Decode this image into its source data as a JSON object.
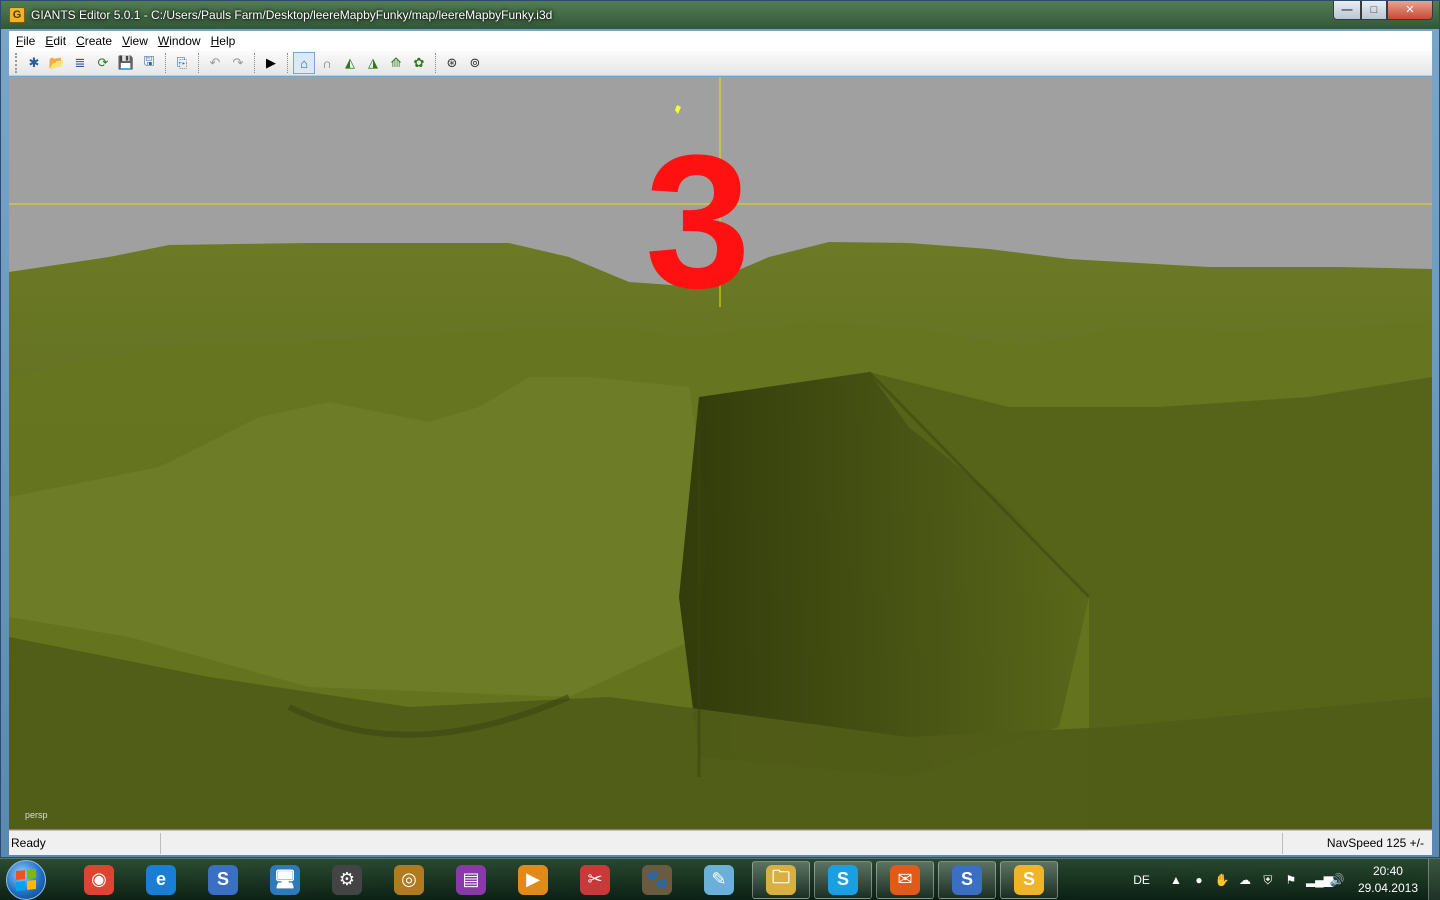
{
  "window": {
    "title": "GIANTS Editor 5.0.1 - C:/Users/Pauls Farm/Desktop/leereMapbyFunky/map/leereMapbyFunky.i3d",
    "app_icon_letter": "G",
    "minimize_label": "—",
    "maximize_label": "□",
    "close_label": "✕"
  },
  "menu": {
    "items": [
      "File",
      "Edit",
      "Create",
      "View",
      "Window",
      "Help"
    ]
  },
  "toolbar": {
    "buttons": [
      {
        "icon": "new-scene-icon",
        "glyph": "✱"
      },
      {
        "icon": "open-icon",
        "glyph": "📂"
      },
      {
        "icon": "import-icon",
        "glyph": "≣"
      },
      {
        "icon": "reload-icon",
        "glyph": "⟳"
      },
      {
        "icon": "save-icon",
        "glyph": "💾"
      },
      {
        "icon": "save-as-icon",
        "glyph": "🖫"
      },
      {
        "icon": "export-icon",
        "glyph": "⎘"
      },
      {
        "icon": "undo-icon",
        "glyph": "↶"
      },
      {
        "icon": "redo-icon",
        "glyph": "↷"
      },
      {
        "icon": "play-icon",
        "glyph": "▶"
      },
      {
        "icon": "select-mode-icon",
        "glyph": "⌂"
      },
      {
        "icon": "move-mode-icon",
        "glyph": "∩"
      },
      {
        "icon": "terrain-sculpt-icon",
        "glyph": "◭"
      },
      {
        "icon": "terrain-paint-icon",
        "glyph": "◮"
      },
      {
        "icon": "terrain-level-icon",
        "glyph": "⟰"
      },
      {
        "icon": "foliage-paint-icon",
        "glyph": "✿"
      },
      {
        "icon": "render-settings-icon",
        "glyph": "⊛"
      },
      {
        "icon": "camera-settings-icon",
        "glyph": "⊚"
      }
    ]
  },
  "viewport": {
    "overlay_number": "3",
    "camera_label": "persp",
    "sky_color": "#a0a0a0",
    "terrain_color": "#5c6b1e",
    "gizmo_color": "#e8e000"
  },
  "status": {
    "left": "Ready",
    "right": "NavSpeed 125 +/-"
  },
  "taskbar": {
    "apps": [
      {
        "icon": "chrome-icon",
        "glyph": "◉",
        "color": "#dd4433",
        "running": false
      },
      {
        "icon": "internet-explorer-icon",
        "glyph": "e",
        "color": "#1a7fd4",
        "running": false
      },
      {
        "icon": "giants-editor-old-icon",
        "glyph": "S",
        "color": "#3a6fc4",
        "running": false
      },
      {
        "icon": "computer-icon",
        "glyph": "🖥",
        "color": "#2e7ab8",
        "running": false
      },
      {
        "icon": "settings-gear-icon",
        "glyph": "⚙",
        "color": "#444444",
        "running": false
      },
      {
        "icon": "disc-burner-icon",
        "glyph": "◎",
        "color": "#b07a20",
        "running": false
      },
      {
        "icon": "winrar-icon",
        "glyph": "▤",
        "color": "#8a3aa8",
        "running": false
      },
      {
        "icon": "media-player-icon",
        "glyph": "▶",
        "color": "#e08a1a",
        "running": false
      },
      {
        "icon": "snipping-tool-icon",
        "glyph": "✂",
        "color": "#c83a3a",
        "running": false
      },
      {
        "icon": "gimp-icon",
        "glyph": "🐾",
        "color": "#6a5a40",
        "running": false
      },
      {
        "icon": "notepad-icon",
        "glyph": "✎",
        "color": "#6ab0d8",
        "running": false
      },
      {
        "icon": "file-explorer-icon",
        "glyph": "🗀",
        "color": "#d8b040",
        "running": true
      },
      {
        "icon": "skype-icon",
        "glyph": "S",
        "color": "#1aa0e0",
        "running": true
      },
      {
        "icon": "mail-icon",
        "glyph": "✉",
        "color": "#e05a1a",
        "running": true
      },
      {
        "icon": "giants-editor-icon",
        "glyph": "S",
        "color": "#3a6fc4",
        "running": true
      },
      {
        "icon": "giants-editor-active-icon",
        "glyph": "S",
        "color": "#f0b429",
        "running": true
      }
    ],
    "language": "DE",
    "tray_icons": [
      {
        "icon": "show-hidden-icons-icon",
        "glyph": "▲"
      },
      {
        "icon": "green-app-tray-icon",
        "glyph": "●"
      },
      {
        "icon": "hand-tray-icon",
        "glyph": "✋"
      },
      {
        "icon": "orange-app-tray-icon",
        "glyph": "☁"
      },
      {
        "icon": "antivirus-tray-icon",
        "glyph": "⛨"
      },
      {
        "icon": "action-center-flag-icon",
        "glyph": "⚑"
      },
      {
        "icon": "network-signal-icon",
        "glyph": "▂▄▆"
      },
      {
        "icon": "volume-icon",
        "glyph": "🔊"
      }
    ],
    "time": "20:40",
    "date": "29.04.2013"
  }
}
